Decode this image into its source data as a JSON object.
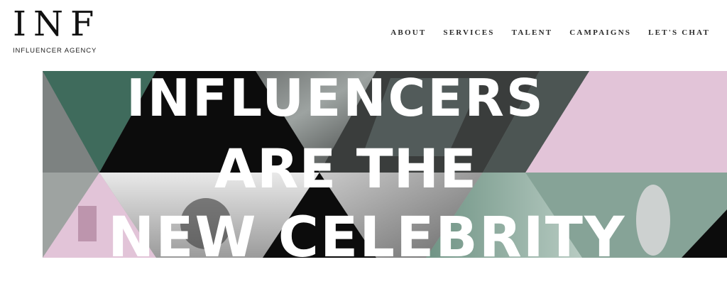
{
  "brand": {
    "logo_text": "INF",
    "tagline": "INFLUENCER AGENCY"
  },
  "nav": {
    "items": [
      {
        "label": "ABOUT"
      },
      {
        "label": "SERVICES"
      },
      {
        "label": "TALENT"
      },
      {
        "label": "CAMPAIGNS"
      },
      {
        "label": "LET'S CHAT"
      }
    ]
  },
  "hero": {
    "headline": {
      "line1": "INFLUENCERS",
      "line2": "ARE THE",
      "line3": "NEW CELEBRITY"
    },
    "colors": {
      "green": "#3f6b5c",
      "pink": "#e2c4d8",
      "black": "#0c0c0c",
      "gray": "#8f9593",
      "mint": "#a9c4b9"
    }
  }
}
